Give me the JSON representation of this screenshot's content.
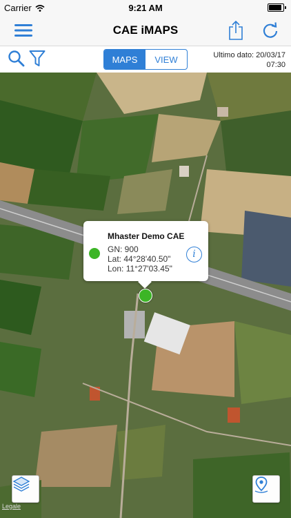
{
  "status_bar": {
    "carrier": "Carrier",
    "time": "9:21 AM",
    "battery_level": 1.0
  },
  "nav": {
    "title": "CAE iMAPS",
    "left_icon": "hamburger-menu-icon",
    "right_icons": [
      "share-icon",
      "refresh-icon"
    ]
  },
  "toolbar": {
    "search_icon": "search-icon",
    "filter_icon": "filter-icon",
    "tabs": [
      {
        "label": "MAPS",
        "active": true
      },
      {
        "label": "VIEW",
        "active": false
      }
    ],
    "last_data_line1": "Ultimo dato: 20/03/17",
    "last_data_line2": "07:30"
  },
  "callout": {
    "title": "Mhaster Demo CAE",
    "gn": "GN: 900",
    "lat": "Lat:  44°28'40.50\"",
    "lon": "Lon:  11°27'03.45\"",
    "status_color": "#3cb526"
  },
  "map_controls": {
    "layers_icon": "layers-icon",
    "locate_icon": "location-pin-icon"
  },
  "legal_label": "Legale",
  "colors": {
    "accent": "#2f7fd6",
    "station_ok": "#3cb526"
  }
}
